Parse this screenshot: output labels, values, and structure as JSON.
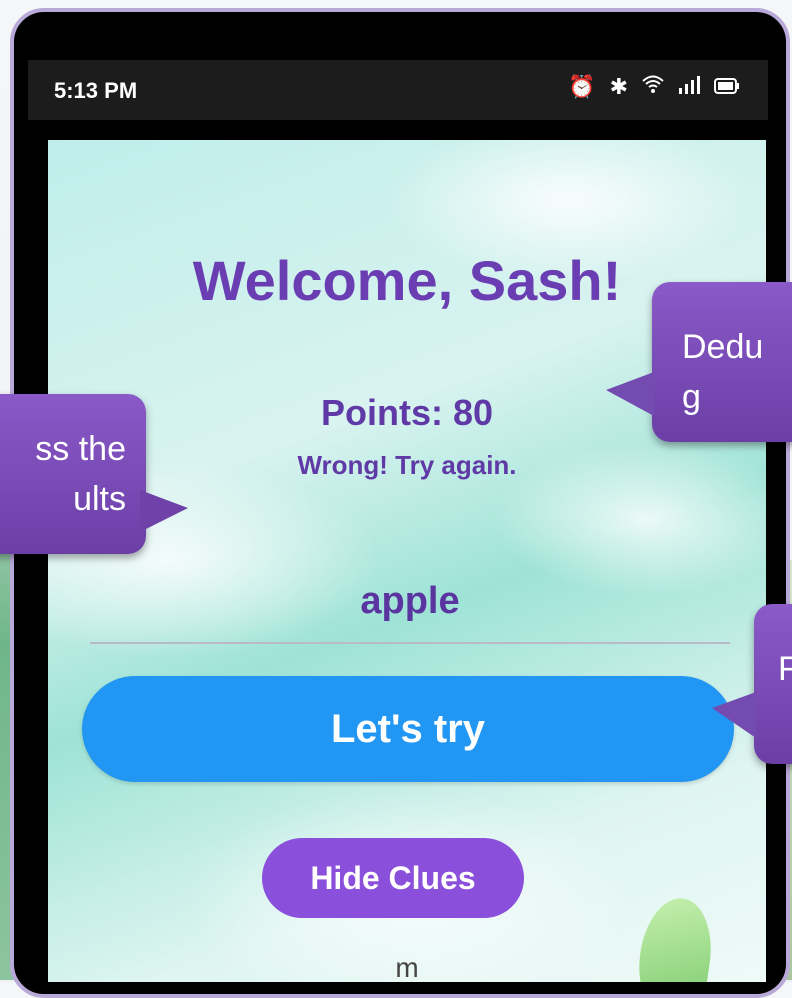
{
  "status_bar": {
    "time": "5:13 PM",
    "icons": [
      "alarm-icon",
      "bluetooth-icon",
      "wifi-icon",
      "signal-icon",
      "battery-icon"
    ]
  },
  "app": {
    "welcome": "Welcome, Sash!",
    "points": "Points: 80",
    "message": "Wrong! Try again.",
    "answer_value": "apple",
    "try_button_label": "Let's try",
    "clue_button_label": "Hide Clues",
    "clue_text": "m"
  },
  "callouts": {
    "left": "ss the\nults",
    "right_top": "Dedu\ng",
    "right_bottom": "F"
  },
  "colors": {
    "title": "#6a3db2",
    "primary_button": "#2196f3",
    "secondary_button": "#8a4fdb",
    "callout": "#7b4bb8"
  }
}
